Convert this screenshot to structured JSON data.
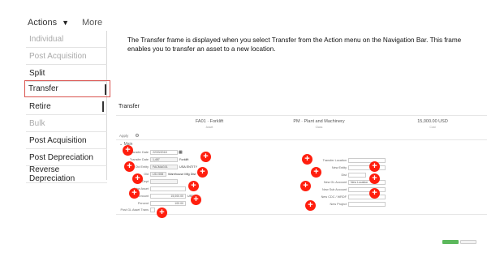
{
  "actions_menu": {
    "button_label": "Actions",
    "caret": "▼",
    "more_label": "More",
    "items": [
      {
        "label": "Individual",
        "style": "grey"
      },
      {
        "label": "Post Acquisition",
        "style": "grey"
      },
      {
        "label": "Split",
        "style": "normal"
      },
      {
        "label": "Transfer",
        "style": "selected"
      },
      {
        "label": "Retire",
        "style": "normal"
      },
      {
        "label": "Bulk",
        "style": "grey"
      },
      {
        "label": "Post Acquisition",
        "style": "normal"
      },
      {
        "label": "Post Depreciation",
        "style": "normal"
      },
      {
        "label": "Reverse Depreciation",
        "style": "normal"
      }
    ]
  },
  "description": "The Transfer frame is displayed when you select Transfer from the Action menu on the Navigation Bar. This frame enables you to transfer an asset to a new location.",
  "transfer_panel": {
    "title": "Transfer",
    "stats": [
      {
        "value": "FA01 · Forklift",
        "label": "Asset"
      },
      {
        "value": "PM · Plant and Machinery",
        "label": "Class"
      },
      {
        "value": "15,000.00 USD",
        "label": "Cost"
      }
    ],
    "toolbar_label": "Apply",
    "section_label": "Main",
    "left_fields": [
      {
        "label": "Transfer Date",
        "value": "22/03/2018"
      },
      {
        "label": "Transfer Date",
        "value": "1,457",
        "suffix": "Forklift"
      },
      {
        "label": "Old Entity",
        "value": "FACMAG01",
        "suffix": "USA ENTITY"
      },
      {
        "label": "Old",
        "value": "LS1 008",
        "suffix": "Warehouse Mfg Dist"
      },
      {
        "label": "Old Dept",
        "value": ""
      },
      {
        "label": "New Asset",
        "value": ""
      },
      {
        "label": "Amount",
        "value": "15,000.00",
        "suffix": "USD"
      },
      {
        "label": "Percent",
        "value": "100.00"
      },
      {
        "label": "Post GL Asset Trans",
        "value": ""
      }
    ],
    "right_fields": [
      {
        "label": "Transfer Location",
        "value": ""
      },
      {
        "label": "New Entity",
        "value": ""
      },
      {
        "label": "Dist",
        "value": ""
      },
      {
        "label": "New GL Account",
        "value": "New Location"
      },
      {
        "label": "New Sub Account",
        "value": ""
      },
      {
        "label": "New CDC / WRDF",
        "value": ""
      },
      {
        "label": "New Project",
        "value": ""
      }
    ],
    "ok_label": "",
    "cancel_label": ""
  },
  "colors": {
    "marker": "#ff1e0e",
    "selected_border": "#d9534f",
    "ok_button": "#5cb85c"
  },
  "marker_icon": "plus-circle-icon"
}
